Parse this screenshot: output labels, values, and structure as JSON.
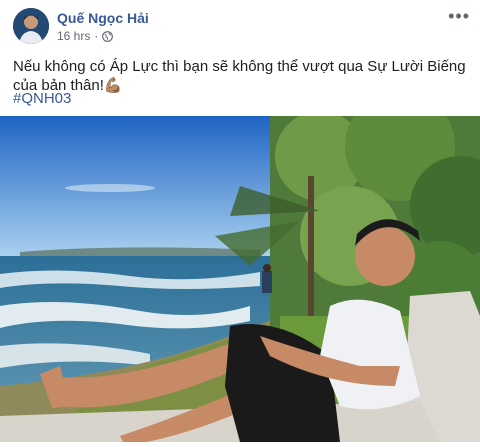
{
  "post": {
    "author": "Quế Ngọc Hải",
    "time": "16 hrs",
    "separator": "·",
    "more": "•••",
    "text": "Nếu không có Áp Lực thì bạn sẽ không thể vượt qua Sự Lười Biếng của bản thân!",
    "emoji": "💪🏽",
    "hashtag": "#QNH03"
  },
  "icons": {
    "privacy": "globe-icon",
    "menu": "more-options-icon"
  },
  "colors": {
    "link": "#385898",
    "meta": "#616770",
    "sky": "#4f8fd8",
    "sea": "#2f6e96"
  }
}
